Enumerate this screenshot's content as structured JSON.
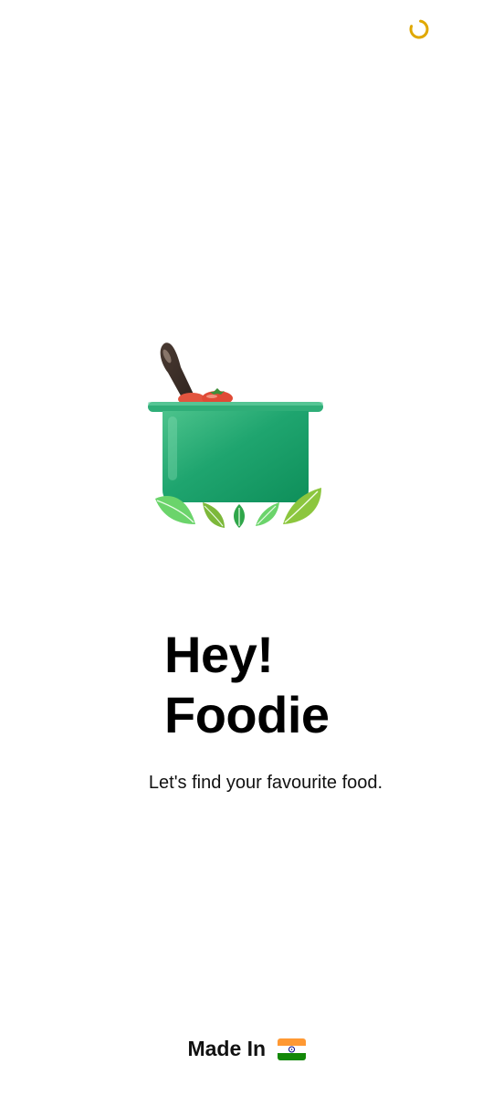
{
  "status": {
    "spinner_icon": "loading-spinner-icon",
    "spinner_color": "#E0A800"
  },
  "hero": {
    "illustration_icon": "cooking-pot-icon",
    "pot_color": "#17A06A",
    "leaf_color": "#7BC043"
  },
  "greeting": {
    "line1": "Hey!",
    "line2": "Foodie"
  },
  "tagline": "Let's find your favourite food.",
  "footer": {
    "made_in_label": "Made In",
    "flag_icon": "india-flag-icon"
  }
}
